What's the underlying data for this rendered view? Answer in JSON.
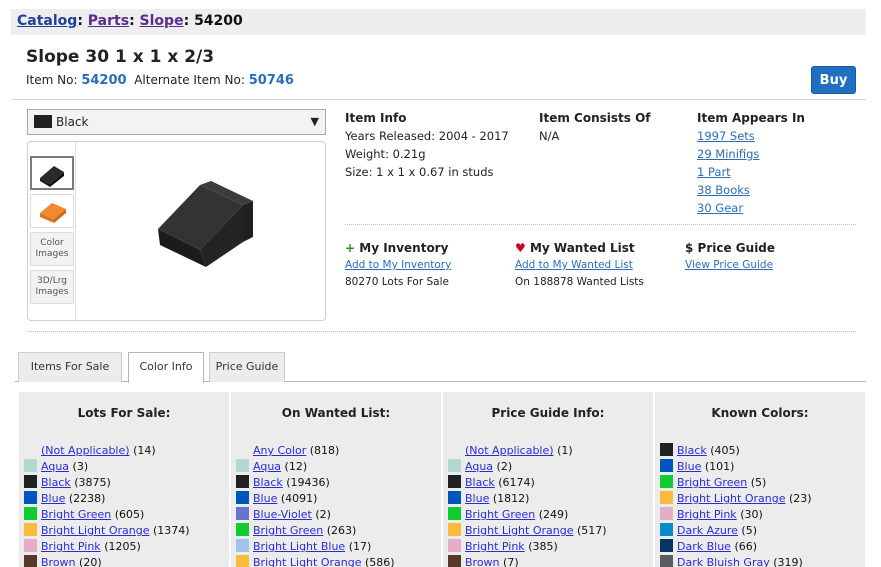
{
  "breadcrumb": {
    "catalog": "Catalog",
    "parts": "Parts",
    "slope": "Slope",
    "sep": ":",
    "current": "54200"
  },
  "item": {
    "title": "Slope 30 1 x 1 x 2/3",
    "item_no_label": "Item No:",
    "item_no": "54200",
    "alt_label": "Alternate Item No:",
    "alt_no": "50746",
    "buy_label": "Buy"
  },
  "color_select": {
    "value": "Black",
    "swatch": "#212121"
  },
  "thumbs": {
    "color_images": "Color Images",
    "lrg_images": "3D/Lrg Images"
  },
  "item_info": {
    "title": "Item Info",
    "years": "Years Released: 2004 - 2017",
    "weight": "Weight: 0.21g",
    "size": "Size: 1 x 1 x 0.67 in studs"
  },
  "consists": {
    "title": "Item Consists Of",
    "value": "N/A"
  },
  "appears": {
    "title": "Item Appears In",
    "links": [
      "1997 Sets",
      "29 Minifigs",
      "1 Part",
      "38 Books",
      "30 Gear"
    ]
  },
  "inventory": {
    "icon": "+",
    "title": "My Inventory",
    "link": "Add to My Inventory",
    "note": "80270 Lots For Sale"
  },
  "wanted": {
    "icon": "♥",
    "title": "My Wanted List",
    "link": "Add to My Wanted List",
    "note": "On 188878 Wanted Lists"
  },
  "price": {
    "icon": "$",
    "title": "Price Guide",
    "link": "View Price Guide"
  },
  "tabs": [
    "Items For Sale",
    "Color Info",
    "Price Guide"
  ],
  "panels": [
    {
      "title": "Lots For Sale:",
      "rows": [
        {
          "name": "(Not Applicable)",
          "count": "(14)",
          "color": ""
        },
        {
          "name": "Aqua",
          "count": "(3)",
          "color": "#b3d7d1"
        },
        {
          "name": "Black",
          "count": "(3875)",
          "color": "#212121"
        },
        {
          "name": "Blue",
          "count": "(2238)",
          "color": "#0055bf"
        },
        {
          "name": "Bright Green",
          "count": "(605)",
          "color": "#10cb31"
        },
        {
          "name": "Bright Light Orange",
          "count": "(1374)",
          "color": "#f8bb3d"
        },
        {
          "name": "Bright Pink",
          "count": "(1205)",
          "color": "#e4adc8"
        },
        {
          "name": "Brown",
          "count": "(20)",
          "color": "#583927"
        }
      ]
    },
    {
      "title": "On Wanted List:",
      "rows": [
        {
          "name": "Any Color",
          "count": "(818)",
          "color": ""
        },
        {
          "name": "Aqua",
          "count": "(12)",
          "color": "#b3d7d1"
        },
        {
          "name": "Black",
          "count": "(19436)",
          "color": "#212121"
        },
        {
          "name": "Blue",
          "count": "(4091)",
          "color": "#0055bf"
        },
        {
          "name": "Blue-Violet",
          "count": "(2)",
          "color": "#6874ca"
        },
        {
          "name": "Bright Green",
          "count": "(263)",
          "color": "#10cb31"
        },
        {
          "name": "Bright Light Blue",
          "count": "(17)",
          "color": "#9fc3e9"
        },
        {
          "name": "Bright Light Orange",
          "count": "(586)",
          "color": "#f8bb3d"
        }
      ]
    },
    {
      "title": "Price Guide Info:",
      "rows": [
        {
          "name": "(Not Applicable)",
          "count": "(1)",
          "color": ""
        },
        {
          "name": "Aqua",
          "count": "(2)",
          "color": "#b3d7d1"
        },
        {
          "name": "Black",
          "count": "(6174)",
          "color": "#212121"
        },
        {
          "name": "Blue",
          "count": "(1812)",
          "color": "#0055bf"
        },
        {
          "name": "Bright Green",
          "count": "(249)",
          "color": "#10cb31"
        },
        {
          "name": "Bright Light Orange",
          "count": "(517)",
          "color": "#f8bb3d"
        },
        {
          "name": "Bright Pink",
          "count": "(385)",
          "color": "#e4adc8"
        },
        {
          "name": "Brown",
          "count": "(7)",
          "color": "#583927"
        }
      ]
    },
    {
      "title": "Known Colors:",
      "rows": [
        {
          "name": "Black",
          "count": "(405)",
          "color": "#212121"
        },
        {
          "name": "Blue",
          "count": "(101)",
          "color": "#0055bf"
        },
        {
          "name": "Bright Green",
          "count": "(5)",
          "color": "#10cb31"
        },
        {
          "name": "Bright Light Orange",
          "count": "(23)",
          "color": "#f8bb3d"
        },
        {
          "name": "Bright Pink",
          "count": "(30)",
          "color": "#e4adc8"
        },
        {
          "name": "Dark Azure",
          "count": "(5)",
          "color": "#078bc9"
        },
        {
          "name": "Dark Blue",
          "count": "(66)",
          "color": "#0a3463"
        },
        {
          "name": "Dark Bluish Gray",
          "count": "(319)",
          "color": "#595d60"
        }
      ]
    }
  ]
}
